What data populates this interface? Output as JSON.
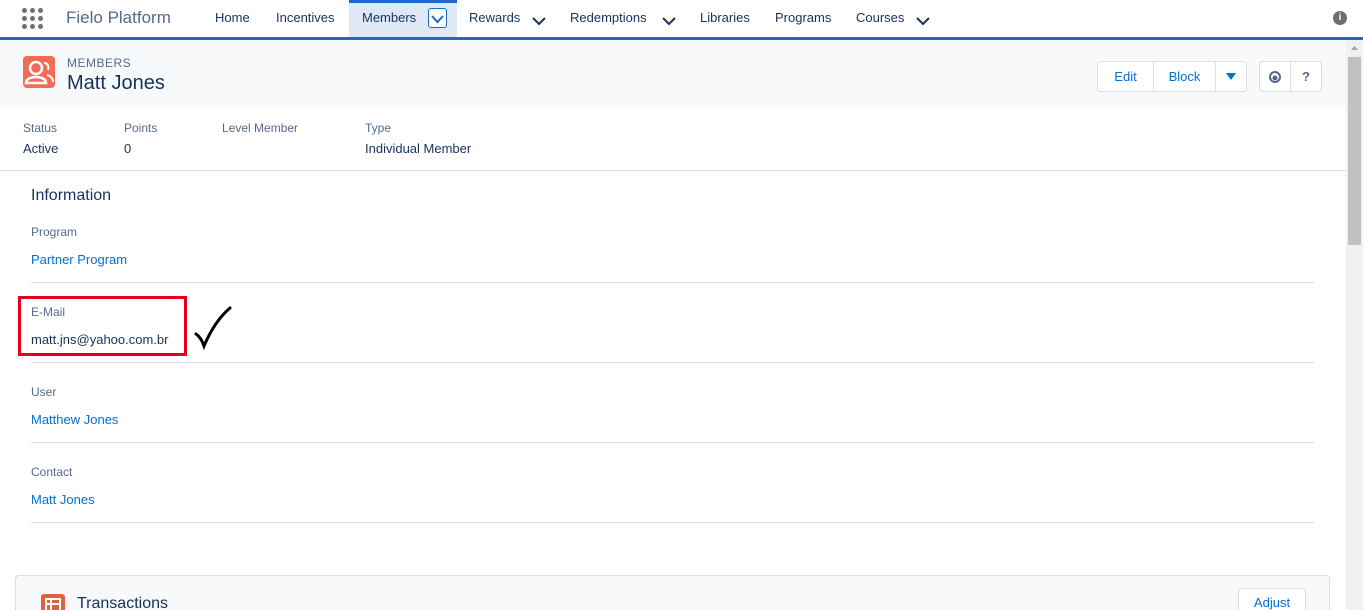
{
  "app": {
    "name": "Fielo Platform"
  },
  "nav": {
    "home": "Home",
    "incentives": "Incentives",
    "members": "Members",
    "rewards": "Rewards",
    "redemptions": "Redemptions",
    "libraries": "Libraries",
    "programs": "Programs",
    "courses": "Courses"
  },
  "header": {
    "object_label": "MEMBERS",
    "record_title": "Matt Jones",
    "edit_label": "Edit",
    "block_label": "Block",
    "help_label": "?"
  },
  "highlights": [
    {
      "label": "Status",
      "value": "Active"
    },
    {
      "label": "Points",
      "value": "0"
    },
    {
      "label": "Level Member",
      "value": ""
    },
    {
      "label": "Type",
      "value": "Individual Member"
    }
  ],
  "details": {
    "section_title": "Information",
    "program_label": "Program",
    "program_value": "Partner Program",
    "email_label": "E-Mail",
    "email_value": "matt.jns@yahoo.com.br",
    "user_label": "User",
    "user_value": "Matthew Jones",
    "contact_label": "Contact",
    "contact_value": "Matt Jones"
  },
  "transactions": {
    "title": "Transactions",
    "adjust_label": "Adjust"
  },
  "icons": {
    "app_launcher": "app-launcher-icon",
    "info": "info-icon",
    "member": "member-icon",
    "follow": "follow-icon",
    "transactions": "transactions-icon"
  },
  "colors": {
    "accent": "#1b6ac7",
    "link": "#0070d2",
    "member_icon": "#f26b57",
    "highlight_box": "#e3001b"
  }
}
